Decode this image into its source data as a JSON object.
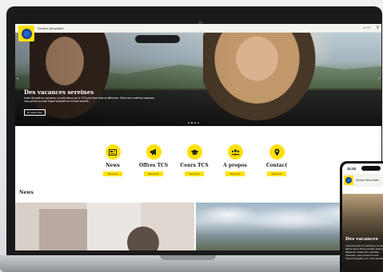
{
  "site": {
    "name": "Section Neuchâtel",
    "lang": "FR",
    "brand_color": "#ffe100"
  },
  "hero": {
    "title": "Des vacances sereines",
    "text": "Avant de partir en vacances, un petit détour par le TCS peut faire toute la différence. Grâce aux contrôles-vacances, vous prenez la route l'esprit tranquille et en toute sécurité.",
    "button": "En savoir plus",
    "arrow_left": "‹",
    "arrow_right": "›",
    "slides": 4,
    "active_slide": 1
  },
  "features": [
    {
      "label": "News",
      "button": "Découvrir",
      "icon": "newspaper-icon"
    },
    {
      "label": "Offres TCS",
      "button": "Découvrir",
      "icon": "megaphone-icon"
    },
    {
      "label": "Cours TCS",
      "button": "Découvrir",
      "icon": "graduation-cap-icon"
    },
    {
      "label": "A propos",
      "button": "Découvrir",
      "icon": "users-icon"
    },
    {
      "label": "Contact",
      "button": "Découvrir",
      "icon": "map-pin-icon"
    }
  ],
  "news": {
    "title": "News"
  },
  "phone": {
    "time": "11:02",
    "site_name": "Section Neuchâtel",
    "hero_title": "Des vacances",
    "hero_text": "Avant de partir en vacances, un petit détour par le TCS peut faire toute la différence. Grâce aux contrôles-vacances, vous prenez la route l'esprit tranquille et en toute sécurité."
  }
}
